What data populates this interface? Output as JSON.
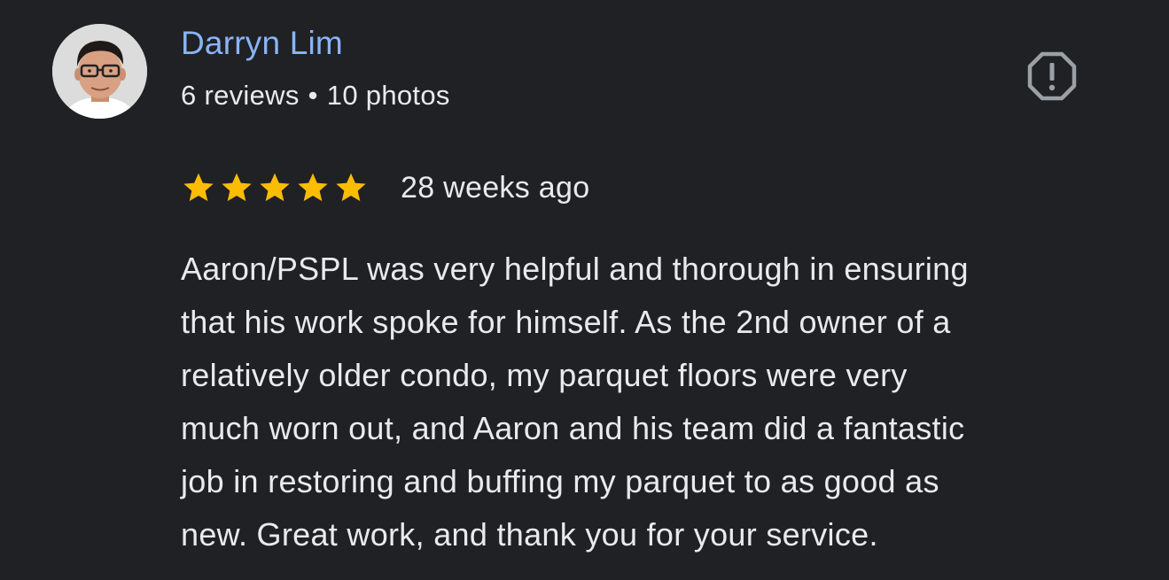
{
  "review": {
    "author": {
      "name": "Darryn Lim",
      "reviews_count": "6 reviews",
      "separator": "•",
      "photos_count": "10 photos",
      "avatar_icon": "person-photo"
    },
    "rating": {
      "stars": 5,
      "max_stars": 5,
      "star_color": "#fbbc04"
    },
    "date": "28 weeks ago",
    "text_lines": [
      "Aaron/PSPL was very helpful and thorough in ensuring",
      "that his work spoke for himself. As the 2nd owner of a",
      "relatively older condo, my parquet floors were very",
      "much worn out, and Aaron and his team did a fantastic",
      "job in restoring and buffing my parquet to as good as",
      "new. Great work, and thank you for your service."
    ],
    "report_icon": "report-flag-icon"
  },
  "colors": {
    "background": "#202124",
    "author_name": "#8ab4f8",
    "text": "#e8eaed",
    "icon": "#9aa0a6"
  }
}
